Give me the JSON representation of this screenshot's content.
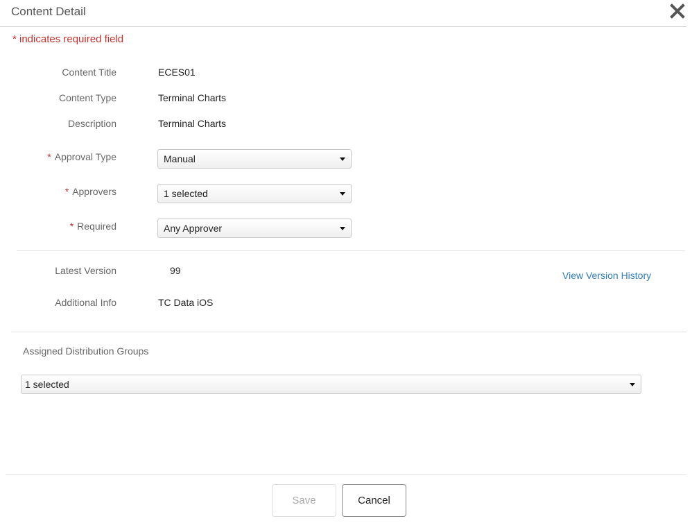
{
  "header": {
    "title": "Content Detail",
    "close_icon": "close-icon"
  },
  "required_note": "* indicates required field",
  "required_star": "*",
  "details": {
    "content_title": {
      "label": "Content Title",
      "value": "ECES01"
    },
    "content_type": {
      "label": "Content Type",
      "value": "Terminal Charts"
    },
    "description": {
      "label": "Description",
      "value": "Terminal Charts"
    }
  },
  "approval": {
    "approval_type": {
      "label": "Approval Type",
      "value": "Manual"
    },
    "approvers": {
      "label": "Approvers",
      "value": "1 selected"
    },
    "required": {
      "label": "Required",
      "value": "Any Approver"
    }
  },
  "version": {
    "latest_version": {
      "label": "Latest Version",
      "value": "99"
    },
    "additional_info": {
      "label": "Additional Info",
      "value": "TC Data iOS"
    },
    "history_link": "View Version History"
  },
  "distribution": {
    "label": "Assigned Distribution Groups",
    "value": "1 selected"
  },
  "footer": {
    "save_label": "Save",
    "cancel_label": "Cancel",
    "save_enabled": false
  },
  "colors": {
    "required": "#c9302c",
    "link": "#2f7bbf"
  }
}
